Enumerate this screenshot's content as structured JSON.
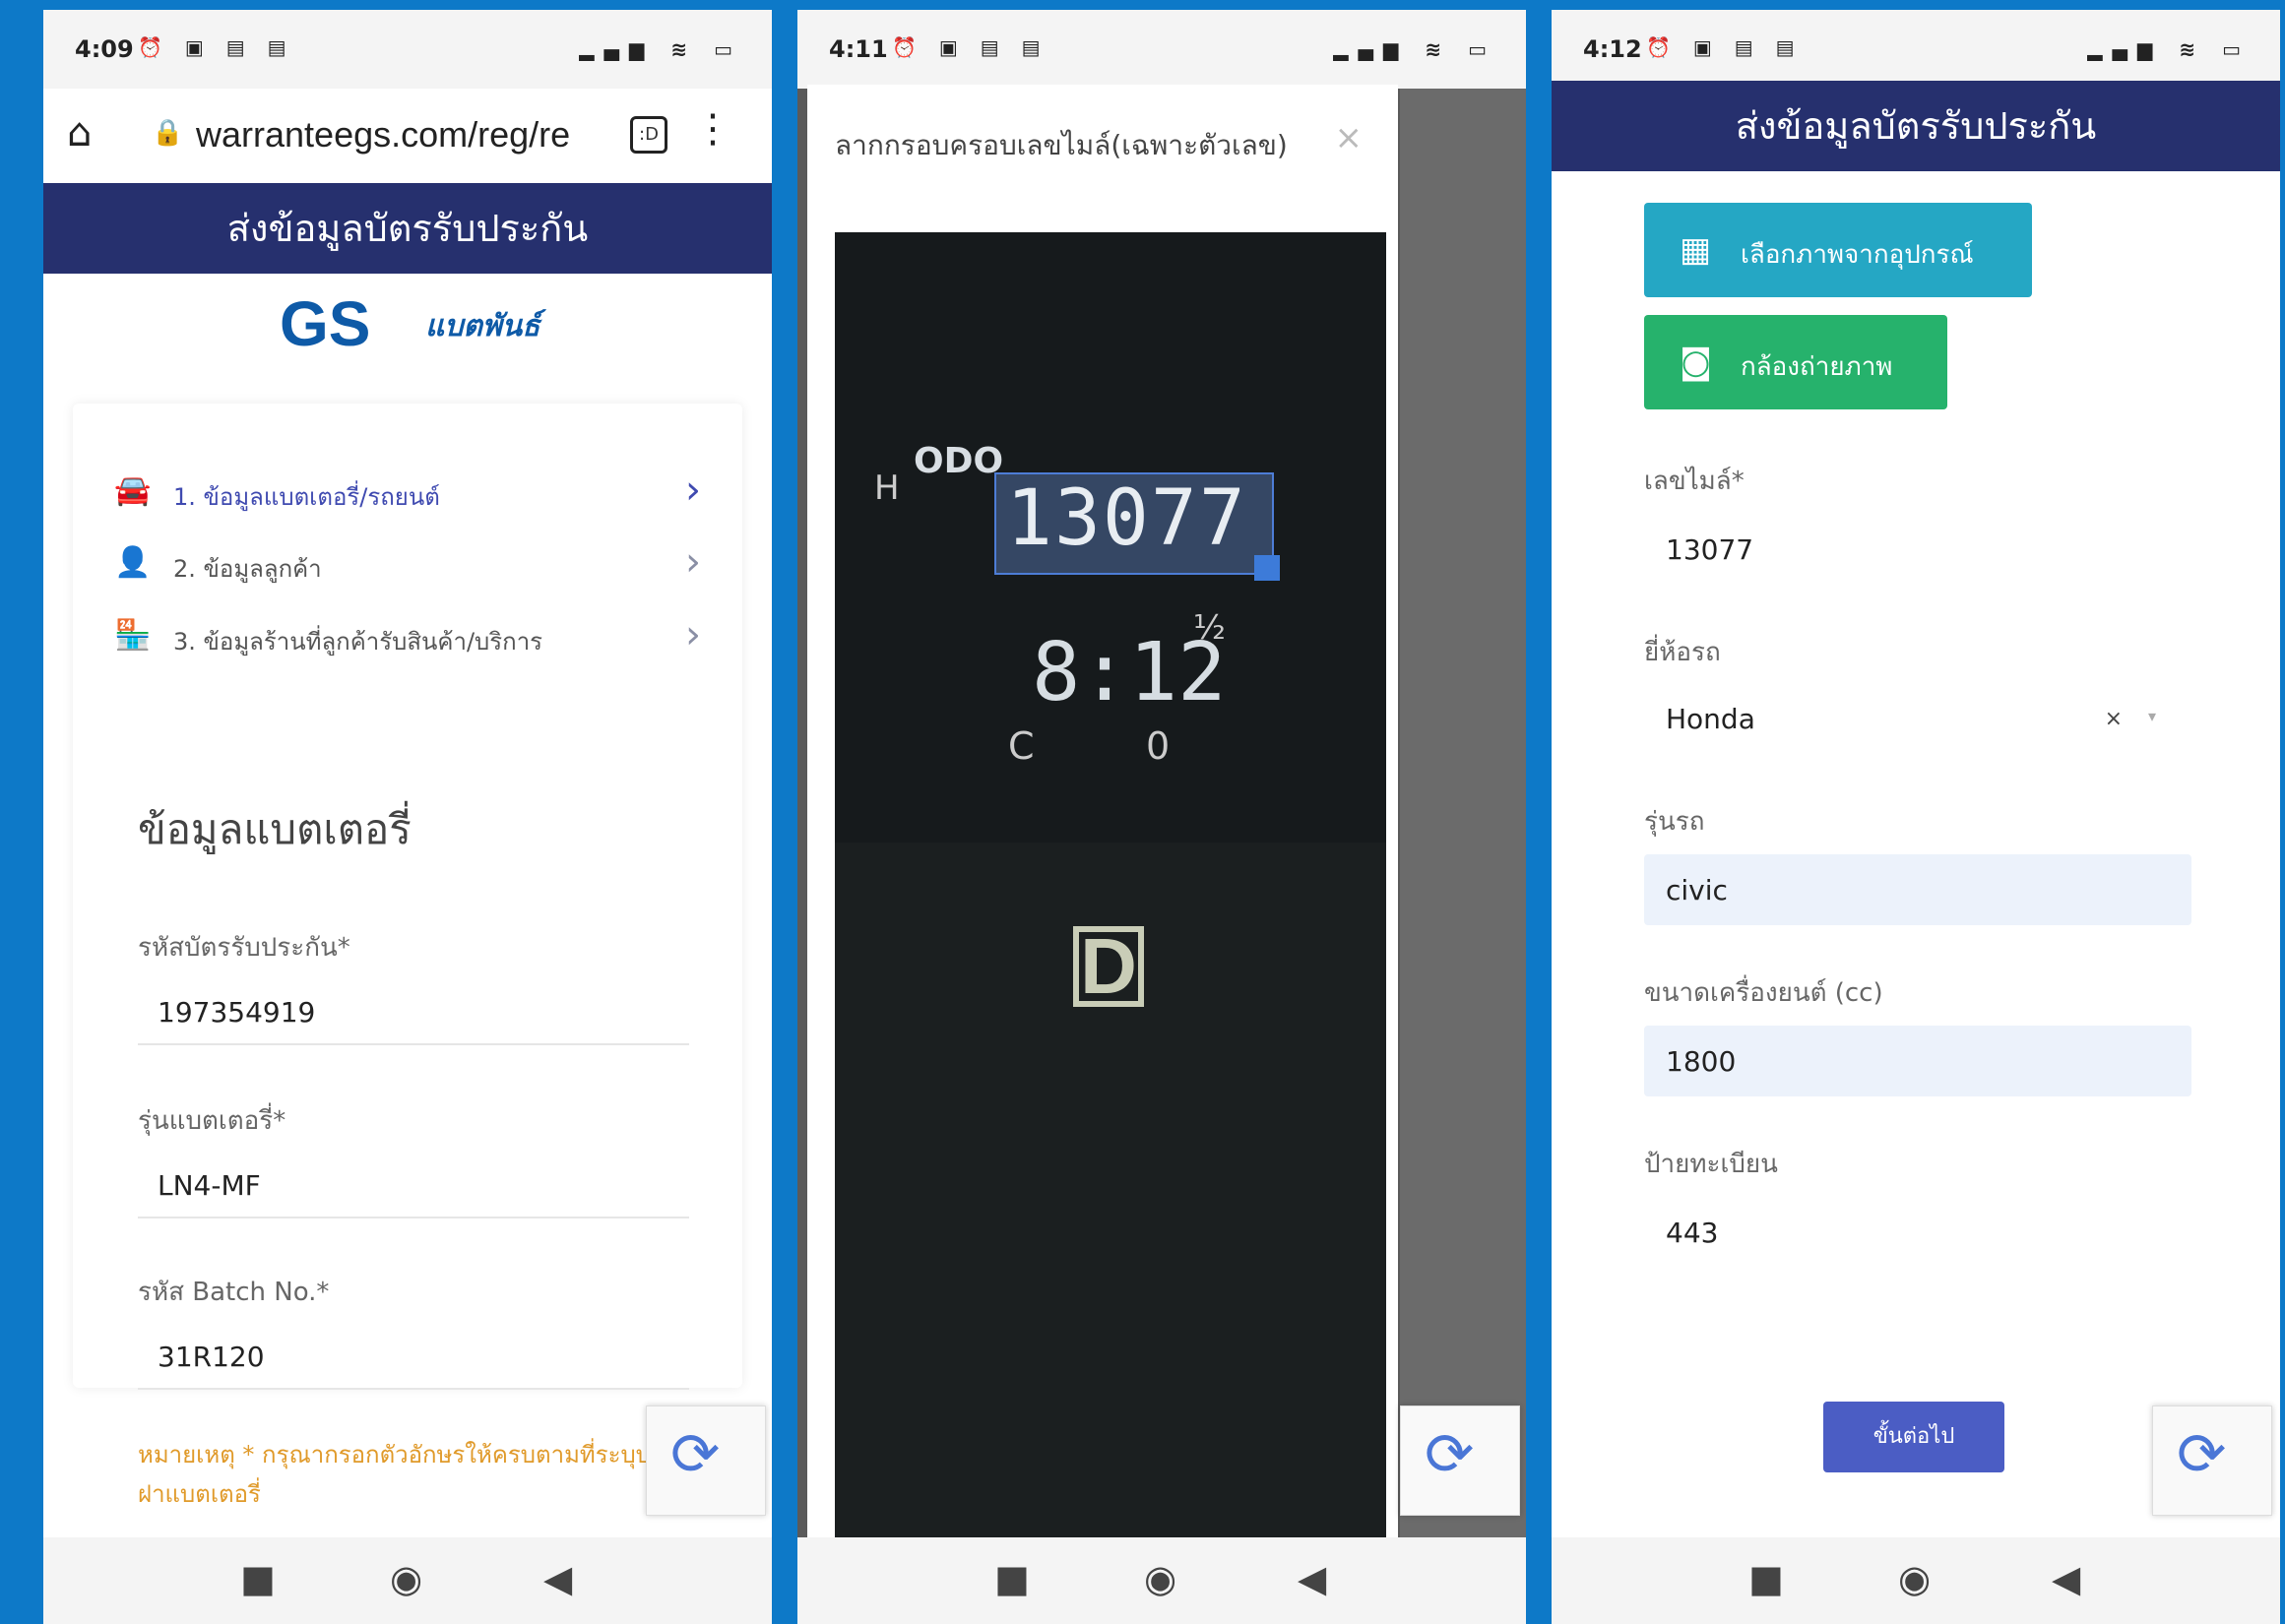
{
  "phone1": {
    "time": "4:09",
    "status_icons": "⏰ ▣ ▤ ▤",
    "signal": "▂▄▆ ≋ ▭",
    "url": "warranteegs.com/reg/re",
    "tab_count": ":D",
    "header": "ส่งข้อมูลบัตรรับประกัน",
    "logo_text": "GS",
    "logo_sub": "แบตพันธ์",
    "steps": [
      {
        "label": "1. ข้อมูลแบตเตอรี่/รถยนต์"
      },
      {
        "label": "2. ข้อมูลลูกค้า"
      },
      {
        "label": "3. ข้อมูลร้านที่ลูกค้ารับสินค้า/บริการ"
      }
    ],
    "section_title": "ข้อมูลแบตเตอรี่",
    "fields": [
      {
        "label": "รหัสบัตรรับประกัน*",
        "value": "197354919"
      },
      {
        "label": "รุ่นแบตเตอรี่*",
        "value": "LN4-MF"
      },
      {
        "label": "รหัส Batch No.*",
        "value": "31R120"
      }
    ],
    "note": "หมายเหตุ * กรุณากรอกตัวอักษรให้ครบตามที่ระบุบนฝาแบตเตอรี่"
  },
  "phone2": {
    "time": "4:11",
    "modal_title": "ลากกรอบครอบเลขไมล์(เฉพาะตัวเลข)",
    "close": "×",
    "odo_label": "ODO",
    "odometer": "13077",
    "clock": "8:12",
    "half": "½",
    "h": "H",
    "c": "C",
    "zero": "0",
    "gear": "D"
  },
  "phone3": {
    "time": "4:12",
    "header": "ส่งข้อมูลบัตรรับประกัน",
    "btn_gallery": "เลือกภาพจากอุปกรณ์",
    "btn_camera": "กล้องถ่ายภาพ",
    "fields": [
      {
        "label": "เลขไมล์*",
        "value": "13077"
      },
      {
        "label": "ยี่ห้อรถ",
        "value": "Honda"
      },
      {
        "label": "รุ่นรถ",
        "value": "civic"
      },
      {
        "label": "ขนาดเครื่องยนต์ (cc)",
        "value": "1800"
      },
      {
        "label": "ป้ายทะเบียน",
        "value": "443"
      }
    ],
    "clear": "×",
    "submit": "ขั้นต่อไป"
  },
  "colors": {
    "background": "#0d79c8",
    "header": "#26306e",
    "gallery_button": "#25a7c4",
    "camera_button": "#26b26c",
    "submit_button": "#4b5dc4",
    "note": "#e09a2a"
  }
}
